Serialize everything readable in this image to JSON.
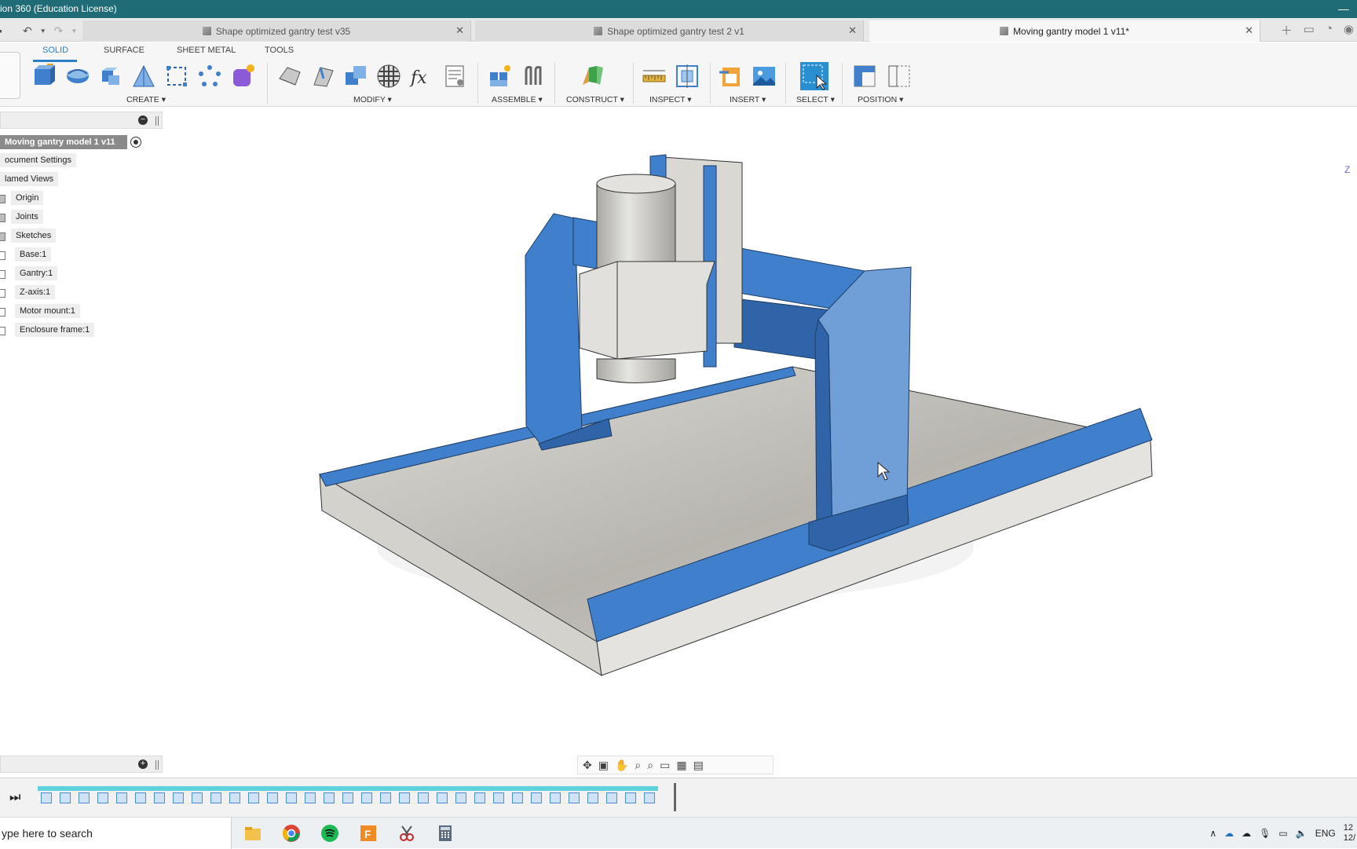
{
  "window": {
    "title": "ion 360 (Education License)",
    "minimize": "—"
  },
  "quick_access": {
    "save": "▪",
    "undo": "↶",
    "redo": "↷"
  },
  "doc_tabs": [
    {
      "label": "Shape optimized gantry test v35",
      "active": false
    },
    {
      "label": "Shape optimized gantry test 2 v1",
      "active": false
    },
    {
      "label": "Moving gantry model 1 v11*",
      "active": true
    }
  ],
  "workspace_tabs": [
    "SOLID",
    "SURFACE",
    "SHEET METAL",
    "TOOLS"
  ],
  "ribbon_groups": [
    "CREATE ▾",
    "MODIFY ▾",
    "ASSEMBLE ▾",
    "CONSTRUCT ▾",
    "INSPECT ▾",
    "INSERT ▾",
    "SELECT ▾",
    "POSITION ▾"
  ],
  "browser": {
    "root": "Moving gantry model 1 v11",
    "items": [
      {
        "label": "ocument Settings"
      },
      {
        "label": "lamed Views"
      },
      {
        "label": "Origin"
      },
      {
        "label": "Joints"
      },
      {
        "label": "Sketches"
      },
      {
        "label": "Base:1"
      },
      {
        "label": "Gantry:1"
      },
      {
        "label": "Z-axis:1"
      },
      {
        "label": "Motor mount:1"
      },
      {
        "label": "Enclosure frame:1"
      }
    ]
  },
  "viewcube_label": "Z",
  "taskbar": {
    "search_placeholder": "ype here to search",
    "language": "ENG",
    "clock_time": "12",
    "clock_date": "12/"
  },
  "colors": {
    "titlebar": "#1f6b76",
    "accent": "#2c7ec7",
    "timeline_track": "#5ed2dd",
    "model_blue": "#3f7fcb",
    "model_gray": "#c9c7c1"
  }
}
